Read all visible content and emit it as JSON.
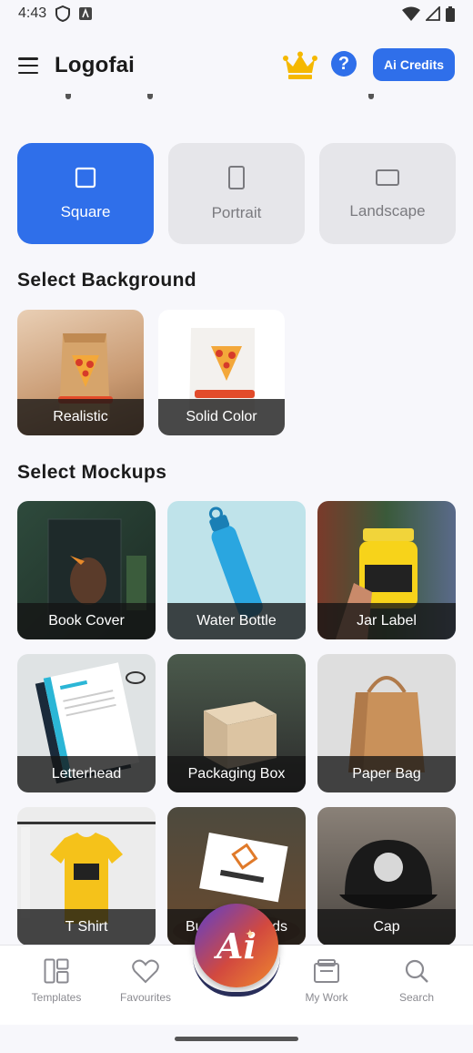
{
  "status_bar": {
    "time": "4:43"
  },
  "app_bar": {
    "title": "Logofai",
    "credits_label": "Ai Credits",
    "help_label": "?"
  },
  "aspect": {
    "options": [
      {
        "label": "Square",
        "selected": true
      },
      {
        "label": "Portrait",
        "selected": false
      },
      {
        "label": "Landscape",
        "selected": false
      }
    ]
  },
  "backgrounds": {
    "title": "Select Background",
    "items": [
      {
        "label": "Realistic"
      },
      {
        "label": "Solid Color"
      }
    ]
  },
  "mockups": {
    "title": "Select Mockups",
    "items": [
      {
        "label": "Book Cover"
      },
      {
        "label": "Water Bottle"
      },
      {
        "label": "Jar Label"
      },
      {
        "label": "Letterhead"
      },
      {
        "label": "Packaging Box"
      },
      {
        "label": "Paper Bag"
      },
      {
        "label": "T Shirt"
      },
      {
        "label": "Business Cards"
      },
      {
        "label": "Cap"
      }
    ]
  },
  "bottom_nav": {
    "items": [
      {
        "label": "Templates",
        "icon": "templates-icon"
      },
      {
        "label": "Favourites",
        "icon": "heart-icon"
      },
      {
        "label": "My Work",
        "icon": "folder-icon"
      },
      {
        "label": "Search",
        "icon": "search-icon"
      }
    ],
    "fab_label": "Ai"
  },
  "colors": {
    "accent": "#2f6fea",
    "crown": "#f5b800"
  }
}
